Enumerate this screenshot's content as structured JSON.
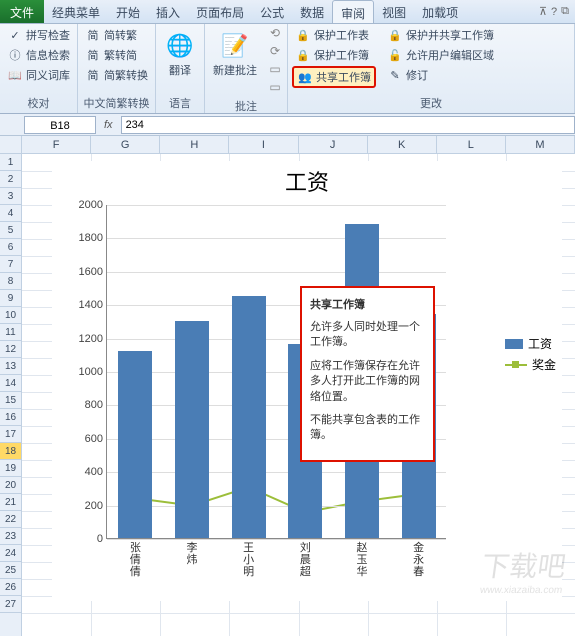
{
  "tabs": {
    "file": "文件",
    "items": [
      "经典菜单",
      "开始",
      "插入",
      "页面布局",
      "公式",
      "数据",
      "审阅",
      "视图",
      "加载项"
    ],
    "active_index": 6
  },
  "ribbon": {
    "groups": [
      {
        "label": "校对",
        "buttons": [
          {
            "name": "spellcheck",
            "icon": "✓",
            "text": "拼写检查"
          },
          {
            "name": "research",
            "icon": "ⓘ",
            "text": "信息检索"
          },
          {
            "name": "thesaurus",
            "icon": "📖",
            "text": "同义词库"
          }
        ]
      },
      {
        "label": "中文简繁转换",
        "buttons": [
          {
            "name": "simp-to-trad",
            "icon": "简",
            "text": "简转繁"
          },
          {
            "name": "trad-to-simp",
            "icon": "简",
            "text": "繁转简"
          },
          {
            "name": "sc-tc-convert",
            "icon": "简",
            "text": "简繁转换"
          }
        ]
      },
      {
        "label": "语言",
        "big": {
          "name": "translate",
          "icon": "🌐",
          "text": "翻译"
        }
      },
      {
        "label": "批注",
        "big": {
          "name": "new-comment",
          "icon": "📝",
          "text": "新建批注"
        },
        "side_icons": [
          "⟲",
          "⟳",
          "▭",
          "▭"
        ]
      },
      {
        "label": "更改",
        "buttons": [
          {
            "name": "protect-sheet",
            "icon": "🔒",
            "text": "保护工作表"
          },
          {
            "name": "protect-workbook",
            "icon": "🔒",
            "text": "保护工作簿"
          },
          {
            "name": "share-workbook",
            "icon": "👥",
            "text": "共享工作簿",
            "highlighted": true
          }
        ],
        "right_buttons": [
          {
            "name": "protect-share",
            "icon": "🔒",
            "text": "保护并共享工作簿"
          },
          {
            "name": "allow-edit-ranges",
            "icon": "🔓",
            "text": "允许用户编辑区域"
          },
          {
            "name": "track-changes",
            "icon": "✎",
            "text": "修订"
          }
        ]
      }
    ]
  },
  "namebar": {
    "cell": "B18",
    "fx": "fx",
    "formula": "234"
  },
  "columns": [
    "F",
    "G",
    "H",
    "I",
    "J",
    "K",
    "L",
    "M"
  ],
  "rows_visible": 27,
  "selected_row": 18,
  "tooltip": {
    "title": "共享工作簿",
    "p1": "允许多人同时处理一个工作簿。",
    "p2": "应将工作簿保存在允许多人打开此工作簿的网络位置。",
    "p3": "不能共享包含表的工作簿。"
  },
  "chart_data": {
    "type": "bar+line",
    "title": "工资",
    "categories": [
      "张倩倩",
      "李炜",
      "王小明",
      "刘晨超",
      "赵玉华",
      "金永春"
    ],
    "series": [
      {
        "name": "工资",
        "type": "bar",
        "color": "#4a7db5",
        "values": [
          1120,
          1300,
          1450,
          1160,
          1880,
          1340
        ]
      },
      {
        "name": "奖金",
        "type": "line",
        "color": "#9cbe3a",
        "values": [
          245,
          200,
          310,
          160,
          225,
          270
        ]
      }
    ],
    "ylabel": "",
    "xlabel": "",
    "ylim": [
      0,
      2000
    ],
    "yticks": [
      0,
      200,
      400,
      600,
      800,
      1000,
      1200,
      1400,
      1600,
      1800,
      2000
    ],
    "legend_position": "right"
  },
  "watermark": {
    "big": "下载吧",
    "small": "www.xiazaiba.com"
  }
}
